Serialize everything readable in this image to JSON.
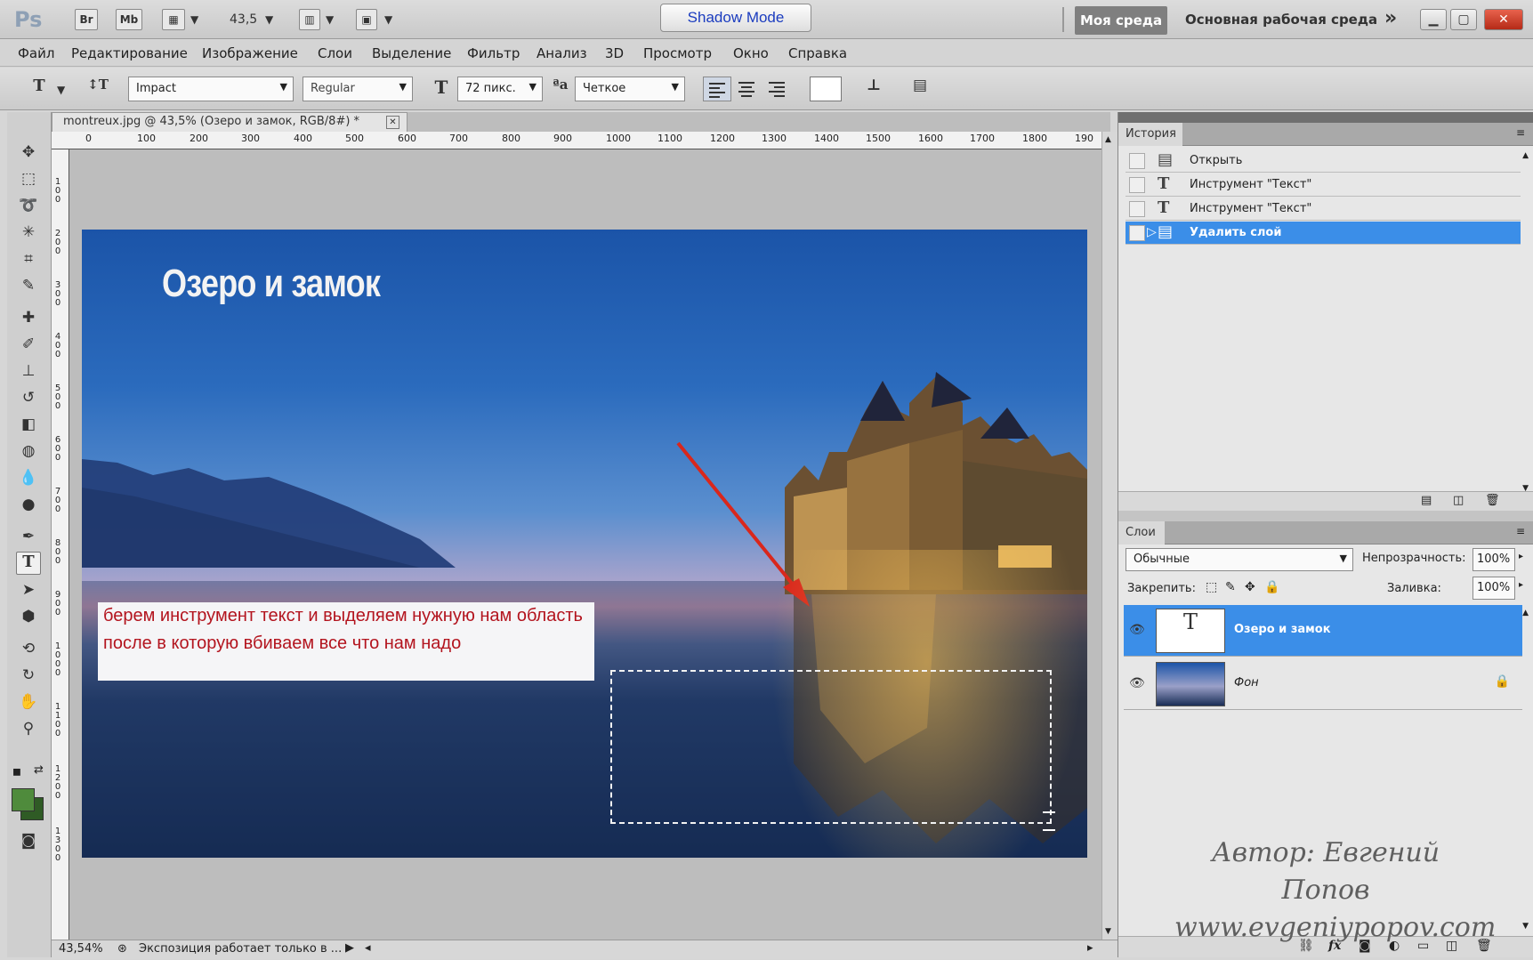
{
  "app": {
    "logo": "Ps",
    "bridge_label": "Br",
    "minibridge_label": "Mb",
    "zoom_value": "43,5",
    "shadow_mode": "Shadow Mode",
    "workspace_button": "Моя среда",
    "workspace_main": "Основная рабочая среда",
    "more": "»"
  },
  "menu": {
    "items": [
      "Файл",
      "Редактирование",
      "Изображение",
      "Слои",
      "Выделение",
      "Фильтр",
      "Анализ",
      "3D",
      "Просмотр",
      "Окно",
      "Справка"
    ]
  },
  "options": {
    "font_family": "Impact",
    "font_style": "Regular",
    "font_size": "72 пикс.",
    "antialias": "Четкое"
  },
  "document": {
    "tab_title": "montreux.jpg @ 43,5% (Озеро и замок, RGB/8#) *",
    "ruler_h": [
      "0",
      "100",
      "200",
      "300",
      "400",
      "500",
      "600",
      "700",
      "800",
      "900",
      "1000",
      "1100",
      "1200",
      "1300",
      "1400",
      "1500",
      "1600",
      "1700",
      "1800",
      "190"
    ],
    "ruler_v": [
      "100",
      "200",
      "300",
      "400",
      "500",
      "600",
      "700",
      "800",
      "900",
      "1000",
      "1100",
      "1200",
      "1300"
    ],
    "image_title": "Озеро и замок",
    "callout": "берем инструмент текст и выделяем нужную нам область после в которую вбиваем все что нам надо",
    "status_zoom": "43,54%",
    "status_text": "Экспозиция работает только в ..."
  },
  "history": {
    "tab": "История",
    "items": [
      {
        "label": "Открыть",
        "icon": "document-icon"
      },
      {
        "label": "Инструмент \"Текст\"",
        "icon": "text-tool-icon"
      },
      {
        "label": "Инструмент \"Текст\"",
        "icon": "text-tool-icon"
      },
      {
        "label": "Удалить слой",
        "icon": "document-icon",
        "selected": true
      }
    ]
  },
  "layers": {
    "tab": "Слои",
    "blend_mode": "Обычные",
    "opacity_label": "Непрозрачность:",
    "opacity_value": "100%",
    "lock_label": "Закрепить:",
    "fill_label": "Заливка:",
    "fill_value": "100%",
    "items": [
      {
        "name": "Озеро и замок",
        "type": "text",
        "selected": true
      },
      {
        "name": "Фон",
        "type": "image",
        "locked": true
      }
    ]
  },
  "watermark": {
    "line1": "Автор: Евгений Попов",
    "line2": "www.evgeniypopov.com"
  },
  "colors": {
    "selection_blue": "#3b8ee8",
    "foreground": "#4f8b3c",
    "callout_text": "#b3141e",
    "arrow": "#d9271c"
  }
}
